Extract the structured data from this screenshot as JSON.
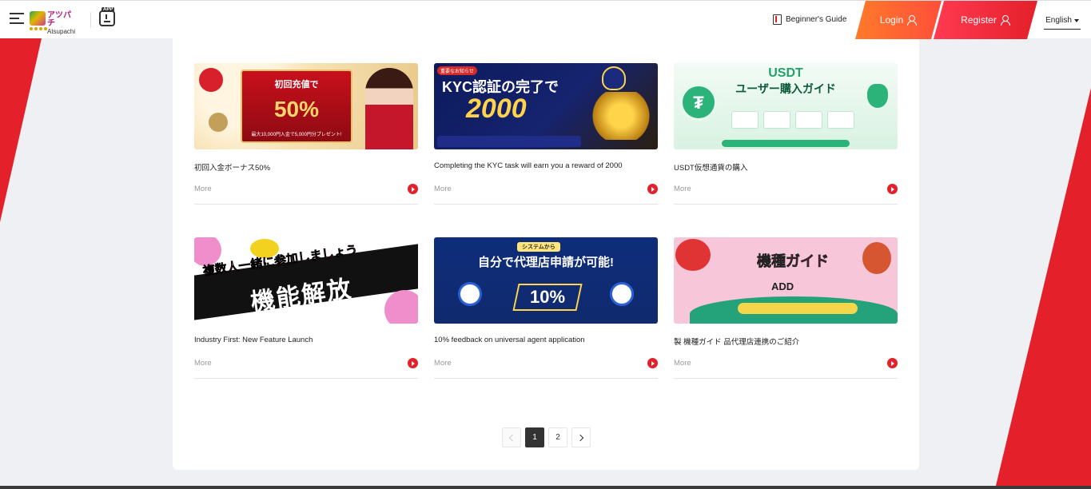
{
  "brand": {
    "logo_text": "アツパチ",
    "logo_subtext": "Atsupachi",
    "app_badge": "APP"
  },
  "header": {
    "guide_label": "Beginner's Guide",
    "login_label": "Login",
    "register_label": "Register",
    "language": "English"
  },
  "colors": {
    "accent_red": "#e4202a",
    "login_orange": "#ff6a30",
    "active_page": "#333333"
  },
  "cards": [
    {
      "title": "初回入金ボーナス50%",
      "more": "More",
      "banner": {
        "head": "初回充値で",
        "value": "50%",
        "foot": "最大10,000円入金で5,000円分プレゼント!"
      }
    },
    {
      "title": "Completing the KYC task will earn you a reward of 2000",
      "more": "More",
      "banner": {
        "tag": "重要なお知らせ",
        "head": "KYC認証の完了で",
        "value": "2000"
      }
    },
    {
      "title": "USDT仮想通貨の購入",
      "more": "More",
      "banner": {
        "head": "USDT",
        "sub": "ユーザー購入ガイド"
      }
    },
    {
      "title": "Industry First: New Feature Launch",
      "more": "More",
      "banner": {
        "head": "複数人一緒に参加しましょう",
        "value": "機能解放"
      }
    },
    {
      "title": "10% feedback on universal agent application",
      "more": "More",
      "banner": {
        "tag": "システムから",
        "head": "自分で代理店申請が可能!",
        "value": "10%"
      }
    },
    {
      "title": "製 機種ガイド 品代理店連携のご紹介",
      "more": "More",
      "banner": {
        "head": "機種ガイド",
        "sub": "ADD"
      }
    }
  ],
  "pagination": {
    "pages": [
      "1",
      "2"
    ],
    "current": "1"
  }
}
